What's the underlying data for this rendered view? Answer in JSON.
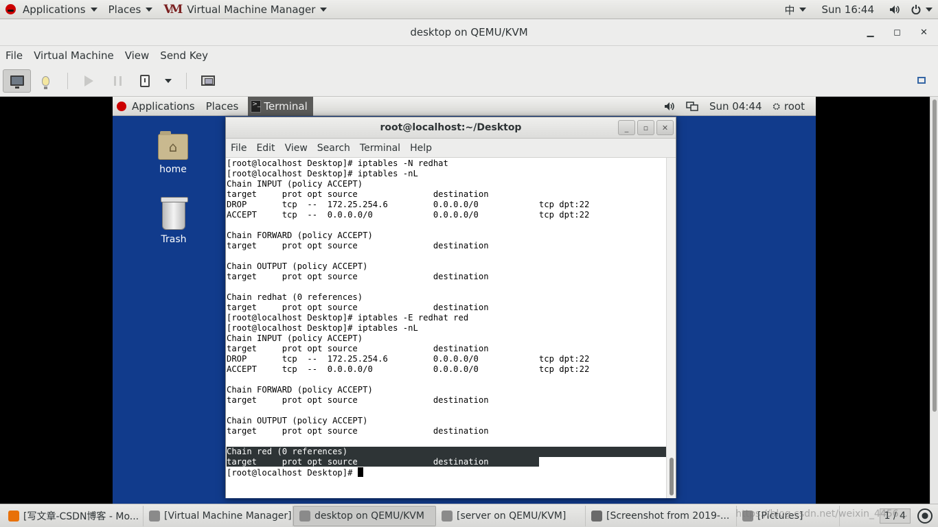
{
  "host_topbar": {
    "applications": "Applications",
    "places": "Places",
    "active_app": "Virtual Machine Manager",
    "input_method": "中",
    "clock": "Sun 16:44"
  },
  "viewer": {
    "title": "desktop on QEMU/KVM",
    "menu": [
      "File",
      "Virtual Machine",
      "View",
      "Send Key"
    ]
  },
  "guest": {
    "topbar": {
      "applications": "Applications",
      "places": "Places",
      "task": "Terminal",
      "clock": "Sun 04:44",
      "user": "root"
    },
    "desktop_icons": [
      {
        "label": "home"
      },
      {
        "label": "Trash"
      }
    ],
    "terminal": {
      "title": "root@localhost:~/Desktop",
      "menu": [
        "File",
        "Edit",
        "View",
        "Search",
        "Terminal",
        "Help"
      ],
      "lines": [
        "[root@localhost Desktop]# iptables -N redhat",
        "[root@localhost Desktop]# iptables -nL",
        "Chain INPUT (policy ACCEPT)",
        "target     prot opt source               destination",
        "DROP       tcp  --  172.25.254.6         0.0.0.0/0            tcp dpt:22",
        "ACCEPT     tcp  --  0.0.0.0/0            0.0.0.0/0            tcp dpt:22",
        "",
        "Chain FORWARD (policy ACCEPT)",
        "target     prot opt source               destination",
        "",
        "Chain OUTPUT (policy ACCEPT)",
        "target     prot opt source               destination",
        "",
        "Chain redhat (0 references)",
        "target     prot opt source               destination",
        "[root@localhost Desktop]# iptables -E redhat red",
        "[root@localhost Desktop]# iptables -nL",
        "Chain INPUT (policy ACCEPT)",
        "target     prot opt source               destination",
        "DROP       tcp  --  172.25.254.6         0.0.0.0/0            tcp dpt:22",
        "ACCEPT     tcp  --  0.0.0.0/0            0.0.0.0/0            tcp dpt:22",
        "",
        "Chain FORWARD (policy ACCEPT)",
        "target     prot opt source               destination",
        "",
        "Chain OUTPUT (policy ACCEPT)",
        "target     prot opt source               destination",
        ""
      ],
      "selected_lines": [
        "Chain red (0 references)",
        "target     prot opt source               destination          "
      ],
      "prompt": "[root@localhost Desktop]# "
    }
  },
  "host_taskbar": {
    "tasks": [
      {
        "label": "[写文章-CSDN博客 - Mo...",
        "active": false,
        "icon_color": "#e8710a"
      },
      {
        "label": "[Virtual Machine Manager]",
        "active": false,
        "icon_color": "#8a8a8a"
      },
      {
        "label": "desktop on QEMU/KVM",
        "active": true,
        "icon_color": "#8a8a8a"
      },
      {
        "label": "[server on QEMU/KVM]",
        "active": false,
        "icon_color": "#8a8a8a"
      },
      {
        "label": "[Screenshot from 2019-...",
        "active": false,
        "icon_color": "#6a6a6a"
      },
      {
        "label": "[Pictures]",
        "active": false,
        "icon_color": "#8a8a8a"
      }
    ],
    "pager": "1 / 4",
    "watermark": "https://blog.csdn.net/weixin_4456..."
  },
  "colors": {
    "guest_desktop": "#113b8c",
    "selection": "#2e3436"
  }
}
